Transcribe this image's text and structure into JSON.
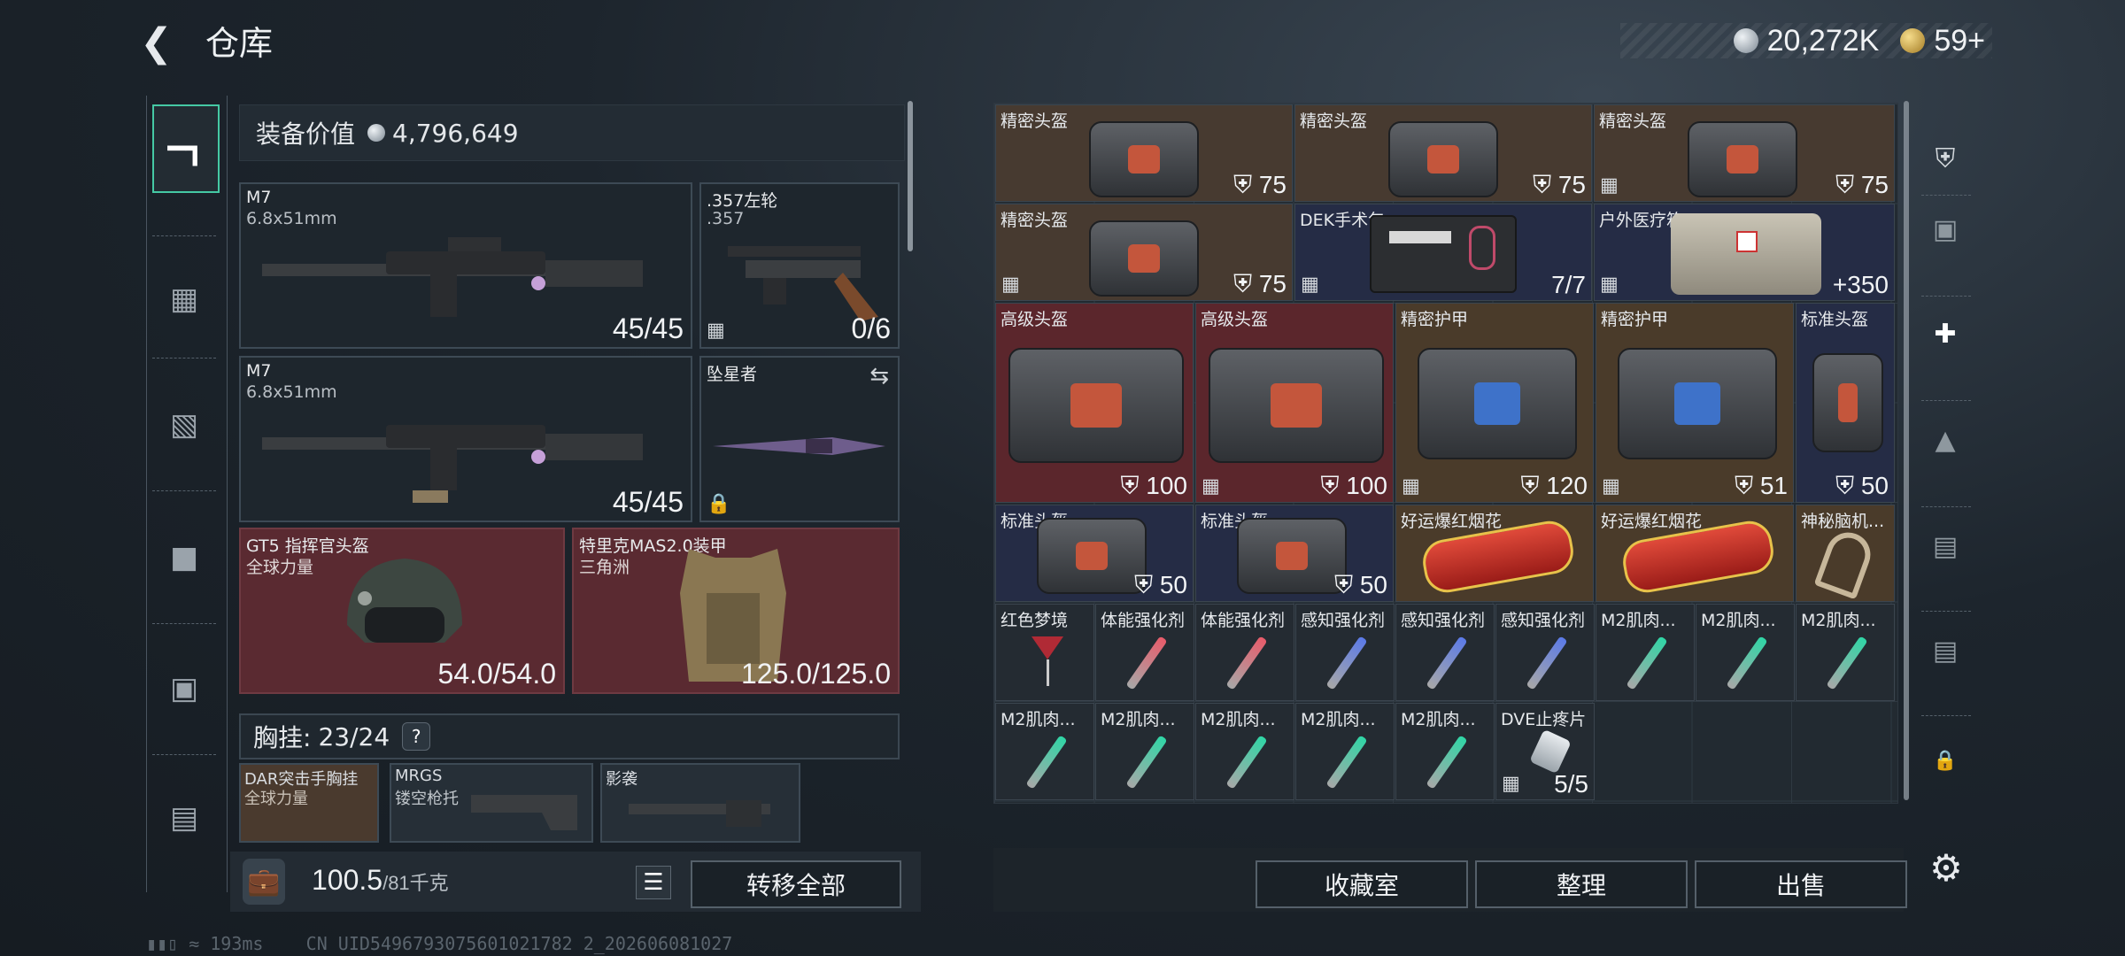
{
  "header": {
    "back_icon": "back-arrow-icon",
    "title": "仓库"
  },
  "currency": {
    "silver": "20,272K",
    "gold": "59+"
  },
  "left_rail": {
    "items": [
      "gun-icon",
      "armor-vest-icon",
      "backpack-icon",
      "pouch-icon",
      "case-icon",
      "toolbox-icon"
    ]
  },
  "equipment_value": {
    "label": "装备价值",
    "value": "4,796,649"
  },
  "weapons": [
    {
      "name": "M7",
      "sub": "6.8x51mm",
      "count": "45/45"
    },
    {
      "name": ".357左轮",
      "sub": ".357",
      "count": "0/6"
    },
    {
      "name": "M7",
      "sub": "6.8x51mm",
      "count": "45/45"
    },
    {
      "name": "坠星者",
      "sub": "",
      "count": ""
    }
  ],
  "gear": [
    {
      "name": "GT5 指挥官头盔",
      "sub": "全球力量",
      "durability": "54.0/54.0"
    },
    {
      "name": "特里克MAS2.0装甲",
      "sub": "三角洲",
      "durability": "125.0/125.0"
    }
  ],
  "chest_rig": {
    "label": "胸挂:",
    "value": "23/24",
    "help": "?"
  },
  "attachments": [
    {
      "name": "DAR突击手胸挂",
      "sub": "全球力量"
    },
    {
      "name": "MRGS",
      "sub": "镂空枪托"
    },
    {
      "name": "影袭",
      "sub": ""
    }
  ],
  "weight": {
    "value": "100.5",
    "max": "/81千克"
  },
  "buttons": {
    "transfer_all": "转移全部",
    "collection": "收藏室",
    "sort": "整理",
    "sell": "出售"
  },
  "status": {
    "ping": "193ms",
    "uid": "CN UID5496793075601021782 2_202606081027"
  },
  "stash": [
    {
      "name": "精密头盔",
      "count": "75"
    },
    {
      "name": "精密头盔",
      "count": "75"
    },
    {
      "name": "精密头盔",
      "count": "75"
    },
    {
      "name": "精密头盔",
      "count": "75"
    },
    {
      "name": "DEK手术包",
      "count": "7/7"
    },
    {
      "name": "户外医疗箱",
      "count": "+350"
    },
    {
      "name": "高级头盔",
      "count": "100"
    },
    {
      "name": "高级头盔",
      "count": "100"
    },
    {
      "name": "精密护甲",
      "count": "120"
    },
    {
      "name": "精密护甲",
      "count": "51"
    },
    {
      "name": "标准头盔",
      "count": "50"
    },
    {
      "name": "标准头盔",
      "count": "50"
    },
    {
      "name": "标准头盔",
      "count": "50"
    },
    {
      "name": "好运爆红烟花",
      "count": ""
    },
    {
      "name": "好运爆红烟花",
      "count": ""
    },
    {
      "name": "神秘脑机...",
      "count": ""
    },
    {
      "name": "红色梦境",
      "count": ""
    },
    {
      "name": "体能强化剂",
      "count": ""
    },
    {
      "name": "体能强化剂",
      "count": ""
    },
    {
      "name": "感知强化剂",
      "count": ""
    },
    {
      "name": "感知强化剂",
      "count": ""
    },
    {
      "name": "感知强化剂",
      "count": ""
    },
    {
      "name": "M2肌肉...",
      "count": ""
    },
    {
      "name": "M2肌肉...",
      "count": ""
    },
    {
      "name": "M2肌肉...",
      "count": ""
    },
    {
      "name": "M2肌肉...",
      "count": ""
    },
    {
      "name": "M2肌肉...",
      "count": ""
    },
    {
      "name": "M2肌肉...",
      "count": ""
    },
    {
      "name": "M2肌肉...",
      "count": ""
    },
    {
      "name": "M2肌肉...",
      "count": ""
    },
    {
      "name": "DVE止疼片",
      "count": "5/5"
    }
  ],
  "right_rail": {
    "items": [
      "helmet-icon",
      "medkit-iv-icon",
      "medkit-plus-iv-icon",
      "armor-iii-icon",
      "gun-iii-icon",
      "gun-iii-b-icon",
      "lock-icon"
    ]
  },
  "colors": {
    "accent": "#45c9a4",
    "red_item": "#5b262c",
    "gold_item": "#4a3b2a"
  }
}
